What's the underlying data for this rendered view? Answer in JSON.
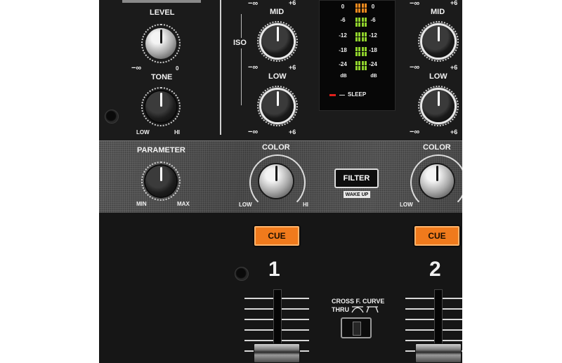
{
  "left_channel": {
    "level_label": "LEVEL",
    "level_min": "−∞",
    "level_max": "0",
    "tone_label": "TONE",
    "tone_min": "LOW",
    "tone_max": "HI"
  },
  "channel1_eq": {
    "top_min": "−∞",
    "top_max": "+6",
    "iso_label": "ISO",
    "mid_label": "MID",
    "mid_min": "−∞",
    "mid_max": "+6",
    "low_label": "LOW",
    "low_min": "−∞",
    "low_max": "+6"
  },
  "channel2_eq": {
    "top_min": "−∞",
    "top_max": "+6",
    "mid_label": "MID",
    "mid_min": "−∞",
    "mid_max": "+6",
    "low_label": "LOW",
    "low_min": "−∞",
    "low_max": "+6"
  },
  "meter": {
    "scale": [
      "0",
      "-6",
      "-12",
      "-18",
      "-24"
    ],
    "unit": "dB",
    "sleep_label": "SLEEP",
    "colors": {
      "orange": "#f08a1e",
      "green": "#8fd12c",
      "sleep_led": "#e0201c"
    }
  },
  "effects": {
    "parameter_label": "PARAMETER",
    "parameter_min": "MIN",
    "parameter_max": "MAX",
    "color1_label": "COLOR",
    "color1_min": "LOW",
    "color1_max": "HI",
    "filter_label": "FILTER",
    "wake_label": "WAKE UP",
    "color2_label": "COLOR",
    "color2_min": "LOW"
  },
  "cue": {
    "ch1_label": "CUE",
    "ch2_label": "CUE",
    "color": "#f07a1c"
  },
  "channels": {
    "ch1_number": "1",
    "ch2_number": "2"
  },
  "crossfader": {
    "title": "CROSS F. CURVE",
    "thru_label": "THRU"
  }
}
